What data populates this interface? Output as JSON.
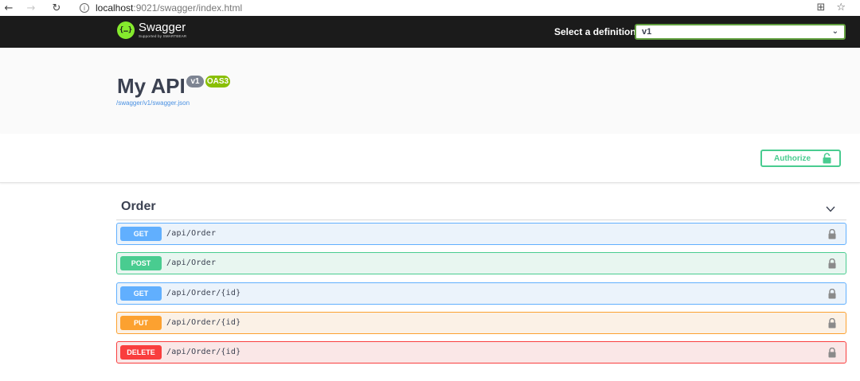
{
  "browser": {
    "back_glyph": "←",
    "forward_glyph": "→",
    "reload_glyph": "↻",
    "url_host": "localhost",
    "url_path": ":9021/swagger/index.html",
    "translate_glyph": "⊞",
    "star_glyph": "☆"
  },
  "topbar": {
    "logo_title": "Swagger",
    "logo_subtitle": "Supported by SMARTBEAR",
    "definition_label": "Select a definition",
    "definition_value": "v1",
    "select_chevron": "⌄"
  },
  "info": {
    "title": "My API",
    "version_badge": "v1",
    "oas_badge": "OAS3",
    "spec_url": "/swagger/v1/swagger.json"
  },
  "scheme": {
    "authorize_label": "Authorize"
  },
  "tag": {
    "name": "Order"
  },
  "operations": [
    {
      "method": "GET",
      "path": "/api/Order",
      "color": "#61affe"
    },
    {
      "method": "POST",
      "path": "/api/Order",
      "color": "#49cc90"
    },
    {
      "method": "GET",
      "path": "/api/Order/{id}",
      "color": "#61affe"
    },
    {
      "method": "PUT",
      "path": "/api/Order/{id}",
      "color": "#fca130"
    },
    {
      "method": "DELETE",
      "path": "/api/Order/{id}",
      "color": "#f93e3e"
    }
  ],
  "colors": {
    "topbar_bg": "#1b1b1b",
    "logo_green": "#85ea2d",
    "authorize_green": "#49cc90"
  }
}
